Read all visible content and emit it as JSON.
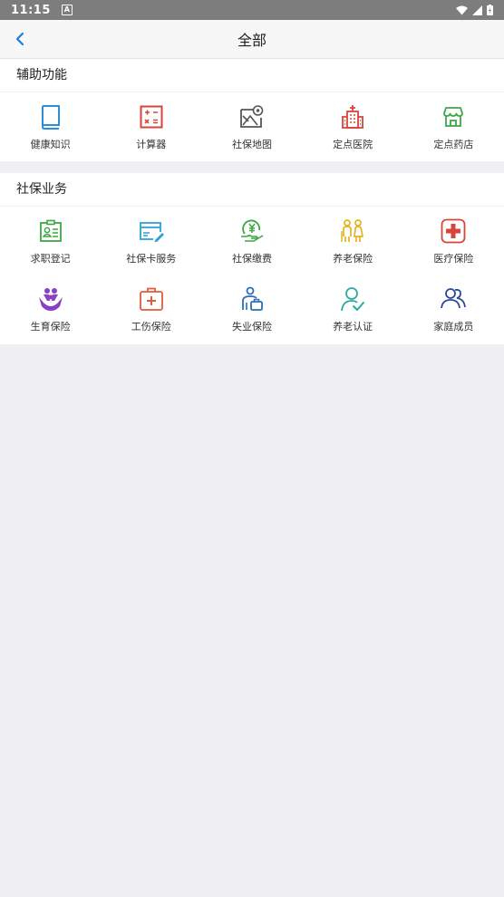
{
  "status": {
    "time": "11:15",
    "notif": "A"
  },
  "header": {
    "title": "全部"
  },
  "sections": [
    {
      "title": "辅助功能",
      "items": [
        {
          "label": "健康知识",
          "icon": "book-icon",
          "color": "#2a8fd8"
        },
        {
          "label": "计算器",
          "icon": "calculator-icon",
          "color": "#d9443a"
        },
        {
          "label": "社保地图",
          "icon": "map-icon",
          "color": "#555555"
        },
        {
          "label": "定点医院",
          "icon": "hospital-icon",
          "color": "#d9443a"
        },
        {
          "label": "定点药店",
          "icon": "pharmacy-icon",
          "color": "#3aa845"
        }
      ]
    },
    {
      "title": "社保业务",
      "items": [
        {
          "label": "求职登记",
          "icon": "job-register-icon",
          "color": "#3aa845"
        },
        {
          "label": "社保卡服务",
          "icon": "card-icon",
          "color": "#2a9fd8"
        },
        {
          "label": "社保缴费",
          "icon": "payment-icon",
          "color": "#3aa845"
        },
        {
          "label": "养老保险",
          "icon": "elderly-icon",
          "color": "#e6b31e"
        },
        {
          "label": "医疗保险",
          "icon": "medical-icon",
          "color": "#d9443a"
        },
        {
          "label": "生育保险",
          "icon": "maternity-icon",
          "color": "#8b3fc4"
        },
        {
          "label": "工伤保险",
          "icon": "injury-icon",
          "color": "#e25b3a"
        },
        {
          "label": "失业保险",
          "icon": "unemployment-icon",
          "color": "#2a6fb8"
        },
        {
          "label": "养老认证",
          "icon": "pension-auth-icon",
          "color": "#2aaba0"
        },
        {
          "label": "家庭成员",
          "icon": "family-icon",
          "color": "#2a4a9a"
        }
      ]
    }
  ]
}
